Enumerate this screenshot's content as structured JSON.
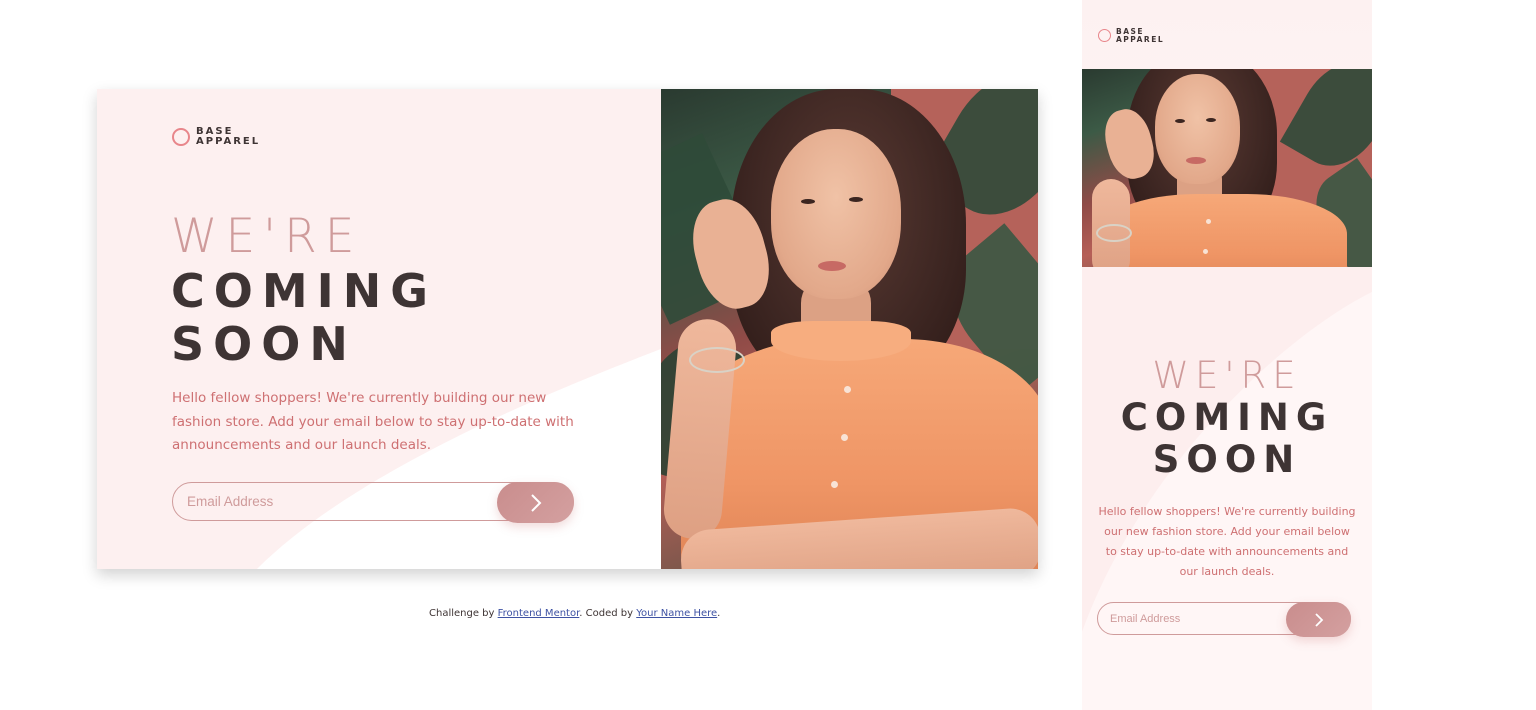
{
  "brand": {
    "line1": "BASE",
    "line2": "APPAREL"
  },
  "headline": {
    "light": "WE'RE",
    "bold1": "COMING",
    "bold2": "SOON"
  },
  "description": "Hello fellow shoppers! We're currently building our new fashion store. Add your email below to stay up-to-date with announcements and our launch deals.",
  "form": {
    "placeholder": "Email Address",
    "submit_icon": "chevron-right-icon"
  },
  "footer": {
    "prefix": "Challenge by ",
    "link1": "Frontend Mentor",
    "middle": ". Coded by ",
    "link2": "Your Name Here",
    "suffix": "."
  },
  "colors": {
    "accent": "#ce7072",
    "light_headline": "#cf9b9b",
    "dark_text": "#3e3434",
    "button_gradient_start": "#c98d8d",
    "button_gradient_end": "#d4a0a0",
    "link": "#3e52a3"
  }
}
